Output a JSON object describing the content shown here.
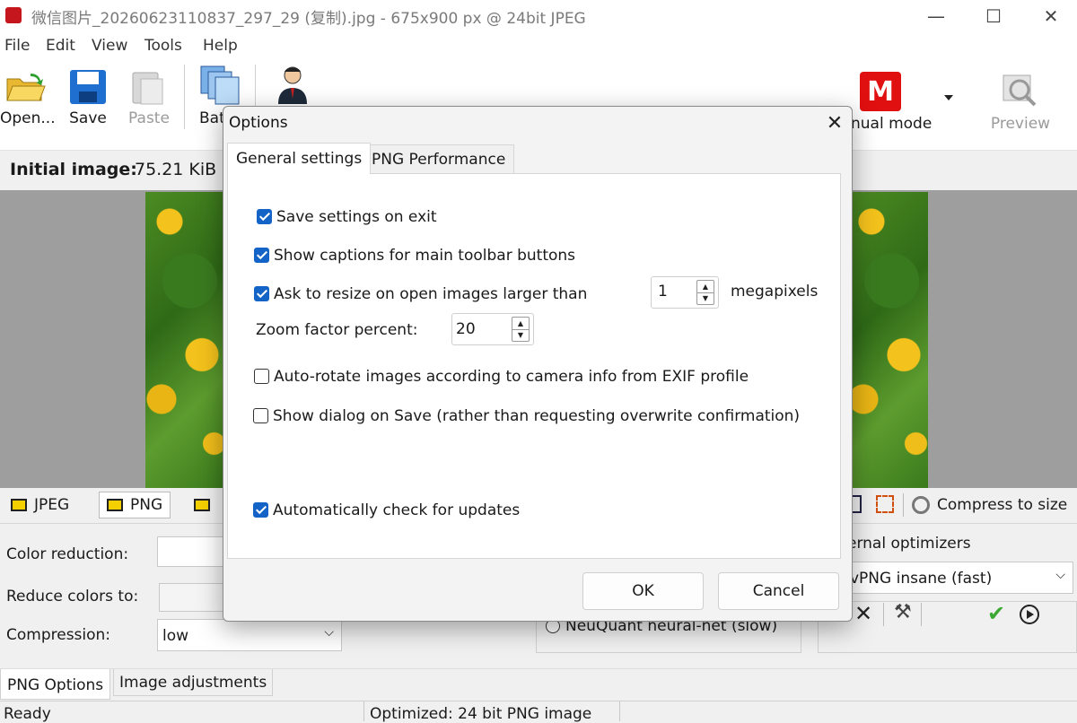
{
  "window": {
    "title": "微信图片_20260623110837_297_29 (复制).jpg - 675x900 px @ 24bit JPEG",
    "minimize_glyph": "—",
    "maximize_glyph": "☐",
    "close_glyph": "✕"
  },
  "menu": [
    "File",
    "Edit",
    "View",
    "Tools",
    "Help"
  ],
  "toolbar": {
    "open": "Open...",
    "save": "Save",
    "paste": "Paste",
    "batch": "Bat",
    "manual_mode_icon_letter": "M",
    "manual_mode": "nual mode",
    "preview": "Preview"
  },
  "info": {
    "initial_label": "Initial image:",
    "initial_size": "75.21 KiB"
  },
  "format_tabs": {
    "jpeg": "JPEG",
    "png": "PNG",
    "compress_to_size": "Compress to size"
  },
  "png_settings": {
    "color_reduction": "Color reduction:",
    "reduce_colors_to": "Reduce colors to:",
    "compression": "Compression:",
    "compression_value": "low",
    "neuquant": "NeuQuant neural-net (slow)",
    "external_optimizers": "ernal optimizers",
    "optimizer_value": "vPNG insane (fast)"
  },
  "bottom_tabs": {
    "png_options": "PNG Options",
    "image_adjustments": "Image adjustments"
  },
  "status": {
    "left": "Ready",
    "middle": "Optimized: 24 bit PNG image"
  },
  "dialog": {
    "title": "Options",
    "tabs": {
      "general": "General settings",
      "png_performance": "PNG Performance"
    },
    "options": {
      "save_on_exit": "Save settings on exit",
      "show_captions": "Show captions for main toolbar buttons",
      "ask_resize": "Ask to resize on open images larger than",
      "megapixels_value": "1",
      "megapixels_label": "megapixels",
      "zoom_label": "Zoom factor percent:",
      "zoom_value": "20",
      "auto_rotate": "Auto-rotate images according to camera info from EXIF profile",
      "show_dialog_on_save": "Show dialog on Save (rather than requesting overwrite confirmation)",
      "auto_check_updates": "Automatically check for updates"
    },
    "checked": {
      "save_on_exit": true,
      "show_captions": true,
      "ask_resize": true,
      "auto_rotate": false,
      "show_dialog_on_save": false,
      "auto_check_updates": true
    },
    "buttons": {
      "ok": "OK",
      "cancel": "Cancel"
    }
  },
  "colors": {
    "accent": "#1464c8",
    "manual_mode_red": "#e01010"
  }
}
